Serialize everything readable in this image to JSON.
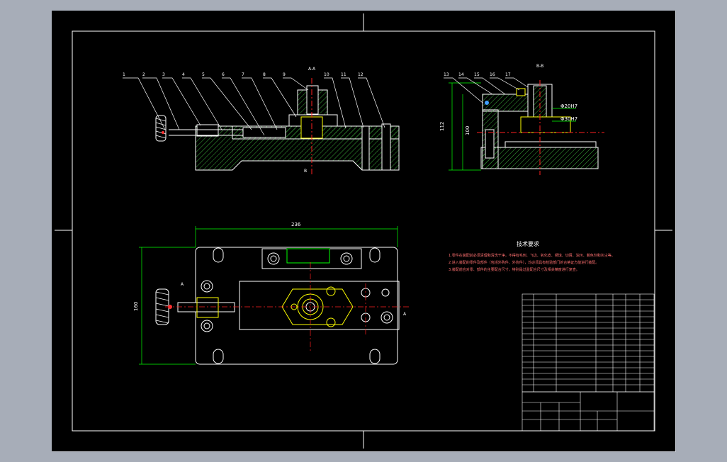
{
  "drawing": {
    "section_aa": "A-A",
    "section_bb": "B-B",
    "section_mark_a": "A",
    "section_mark_b": "B",
    "balloons_front": [
      "1",
      "2",
      "3",
      "4",
      "5",
      "6",
      "7",
      "8",
      "9",
      "10",
      "11",
      "12"
    ],
    "balloons_side": [
      "13",
      "14",
      "15",
      "16",
      "17"
    ],
    "dims": {
      "width_top": "236",
      "height_left": "160",
      "height_side_outer": "112",
      "height_side_inner": "100",
      "fit_1": "Φ20H7",
      "fit_2": "Φ30H7"
    },
    "tech_title": "技术要求",
    "tech_notes": [
      "1.零件在装配前必须清理和清洗干净，不得有毛刺、飞边、氧化皮、锈蚀、切屑、油污、着色剂和灰尘等。",
      "2.进入装配的零件及部件（包括外购件、外协件），均必须具有检验部门的合格证方能进行装配。",
      "3.装配前应对零、部件的主要配合尺寸，特别是过盈配合尺寸及相关精度进行复查。"
    ]
  },
  "colors": {
    "sheet_bg": "#000000",
    "line": "#ffffff",
    "hatch": "#00ff00",
    "center": "#ff2020",
    "part": "#ffff00",
    "dim_line": "#00ff00"
  }
}
